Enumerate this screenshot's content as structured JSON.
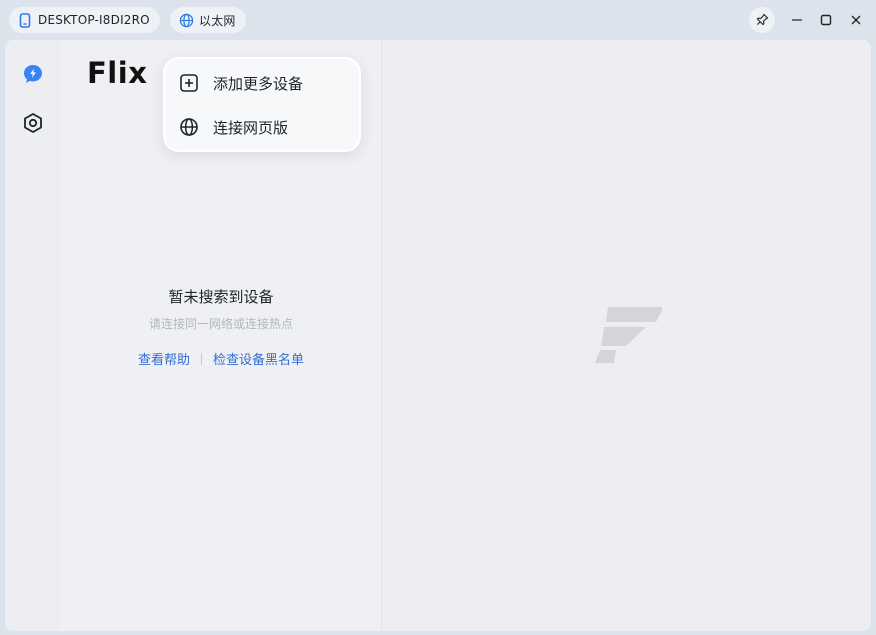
{
  "titlebar": {
    "device_name": "DESKTOP-I8DI2RO",
    "network_name": "以太网",
    "icons": [
      "phone-icon",
      "globe-icon",
      "pin-icon",
      "minimize-icon",
      "maximize-icon",
      "close-icon"
    ]
  },
  "sidebar": {
    "icons": [
      "flash-bubble-icon",
      "settings-hexagon-icon"
    ]
  },
  "app": {
    "logo_text": "Flix"
  },
  "popup_menu": {
    "items": [
      {
        "label": "添加更多设备",
        "icon": "add-square-icon"
      },
      {
        "label": "连接网页版",
        "icon": "globe-icon"
      }
    ]
  },
  "empty_state": {
    "title": "暂未搜索到设备",
    "subtitle": "请连接同一网络或连接热点",
    "help_link": "查看帮助",
    "blacklist_link": "检查设备黑名单"
  },
  "colors": {
    "accent": "#2f6fd6",
    "rail_icon_active": "#3b82f6",
    "background": "#dde3ec"
  }
}
